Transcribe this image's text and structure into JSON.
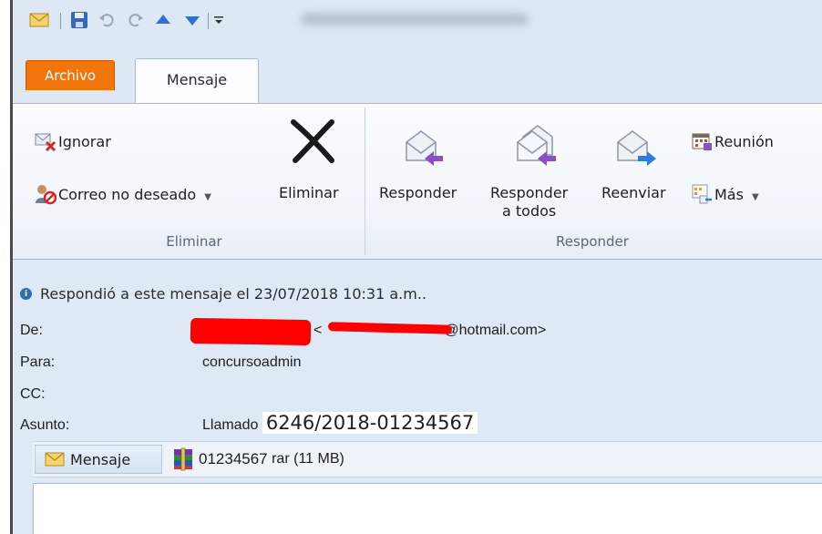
{
  "quick_access": {
    "icons": [
      "mail-icon",
      "save-icon",
      "undo-icon",
      "redo-icon",
      "previous-item-icon",
      "next-item-icon",
      "customize-toolbar-icon"
    ]
  },
  "tabs": [
    {
      "label": "Archivo",
      "active": false
    },
    {
      "label": "Mensaje",
      "active": true
    }
  ],
  "ribbon": {
    "groups": [
      {
        "label": "Eliminar",
        "buttons": [
          {
            "label": "Ignorar",
            "icon": "ignore-icon"
          },
          {
            "label": "Correo no deseado",
            "icon": "junk-mail-icon",
            "dropdown": true
          },
          {
            "label": "Eliminar",
            "icon": "delete-x-icon"
          }
        ]
      },
      {
        "label": "Responder",
        "buttons": [
          {
            "label": "Responder",
            "icon": "reply-icon"
          },
          {
            "label": "Responder",
            "label2": "a todos",
            "icon": "reply-all-icon"
          },
          {
            "label": "Reenviar",
            "icon": "forward-icon"
          },
          {
            "label": "Reunión",
            "icon": "meeting-icon"
          },
          {
            "label": "Más",
            "icon": "more-icon",
            "dropdown": true
          }
        ]
      }
    ]
  },
  "message": {
    "info_text": "Respondió a este mensaje el 23/07/2018 10:31 a.m..",
    "from_label": "De:",
    "from_value_start": "<",
    "from_value_end": "@hotmail.com>",
    "to_label": "Para:",
    "to_value": "concursoadmin",
    "cc_label": "CC:",
    "subject_label": "Asunto:",
    "subject_prefix": "Llamado",
    "subject_number": "6246/2018-01234567"
  },
  "attachments": {
    "message_tab": "Mensaje",
    "file_name": "01234567",
    "file_ext": "rar",
    "file_size": "(11 MB)"
  },
  "colors": {
    "file_tab": "#f0760c",
    "redaction": "#ff0000",
    "window_bg": "#dfe9f5"
  }
}
